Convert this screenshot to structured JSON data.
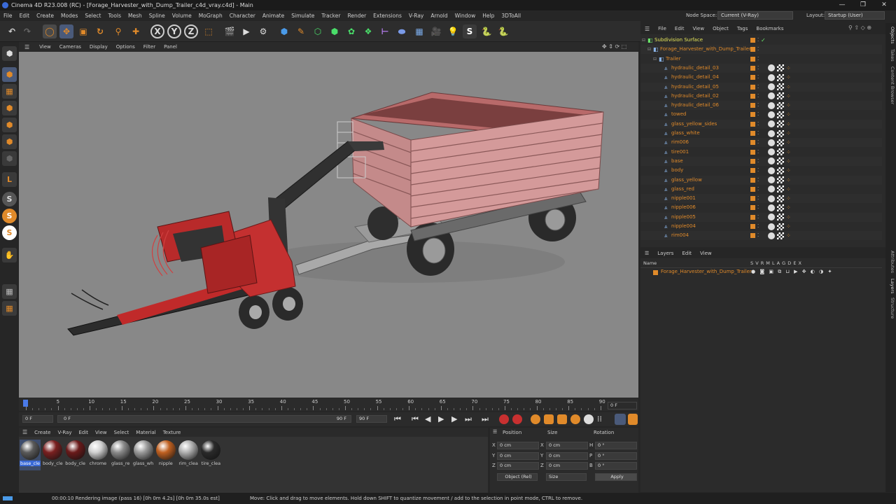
{
  "title_bar": {
    "text": "Cinema 4D R23.008 (RC) - [Forage_Harvester_with_Dump_Trailer_c4d_vray.c4d] - Main",
    "minimize": "—",
    "maximize": "❐",
    "close": "✕"
  },
  "menu": [
    "File",
    "Edit",
    "Create",
    "Modes",
    "Select",
    "Tools",
    "Mesh",
    "Spline",
    "Volume",
    "MoGraph",
    "Character",
    "Animate",
    "Simulate",
    "Tracker",
    "Render",
    "Extensions",
    "V-Ray",
    "Arnold",
    "Window",
    "Help",
    "3DToAll"
  ],
  "node_space": {
    "label": "Node Space:",
    "value": "Current (V-Ray)"
  },
  "layout": {
    "label": "Layout:",
    "value": "Startup (User)"
  },
  "viewport_menu": [
    "View",
    "Cameras",
    "Display",
    "Options",
    "Filter",
    "Panel"
  ],
  "object_menu": [
    "File",
    "Edit",
    "View",
    "Object",
    "Tags",
    "Bookmarks"
  ],
  "objects": [
    {
      "name": "Subdivision Surface",
      "level": 0,
      "color": "#e6e65a"
    },
    {
      "name": "Forage_Harvester_with_Dump_Trailer",
      "level": 1,
      "color": "#e08a2a"
    },
    {
      "name": "Trailer",
      "level": 2,
      "color": "#e08a2a"
    },
    {
      "name": "hydraulic_detail_03",
      "level": 3,
      "color": "#e08a2a"
    },
    {
      "name": "hydraulic_detail_04",
      "level": 3,
      "color": "#e08a2a"
    },
    {
      "name": "hydraulic_detail_05",
      "level": 3,
      "color": "#e08a2a"
    },
    {
      "name": "hydraulic_detail_02",
      "level": 3,
      "color": "#e08a2a"
    },
    {
      "name": "hydraulic_detail_06",
      "level": 3,
      "color": "#e08a2a"
    },
    {
      "name": "towed",
      "level": 3,
      "color": "#e08a2a"
    },
    {
      "name": "glass_yellow_sides",
      "level": 3,
      "color": "#e08a2a"
    },
    {
      "name": "glass_white",
      "level": 3,
      "color": "#e08a2a"
    },
    {
      "name": "rim006",
      "level": 3,
      "color": "#e08a2a"
    },
    {
      "name": "tire001",
      "level": 3,
      "color": "#e08a2a"
    },
    {
      "name": "base",
      "level": 3,
      "color": "#e08a2a"
    },
    {
      "name": "body",
      "level": 3,
      "color": "#e08a2a"
    },
    {
      "name": "glass_yellow",
      "level": 3,
      "color": "#e08a2a"
    },
    {
      "name": "glass_red",
      "level": 3,
      "color": "#e08a2a"
    },
    {
      "name": "nipple001",
      "level": 3,
      "color": "#e08a2a"
    },
    {
      "name": "nipple006",
      "level": 3,
      "color": "#e08a2a"
    },
    {
      "name": "nipple005",
      "level": 3,
      "color": "#e08a2a"
    },
    {
      "name": "nipple004",
      "level": 3,
      "color": "#e08a2a"
    },
    {
      "name": "rim004",
      "level": 3,
      "color": "#e08a2a"
    }
  ],
  "layers_menu": [
    "Layers",
    "Edit",
    "View"
  ],
  "layers_header": {
    "name": "Name",
    "cols": "S V R M L A G D E X"
  },
  "layers": [
    {
      "name": "Forage_Harvester_with_Dump_Trailer"
    }
  ],
  "timeline": {
    "ticks": [
      "0",
      "5",
      "10",
      "15",
      "20",
      "25",
      "30",
      "35",
      "40",
      "45",
      "50",
      "55",
      "60",
      "65",
      "70",
      "75",
      "80",
      "85",
      "90"
    ],
    "current": "0 F",
    "start": "0 F",
    "range_start": "0 F",
    "range_end": "90 F",
    "end": "90 F"
  },
  "material_menu": [
    "Create",
    "V-Ray",
    "Edit",
    "View",
    "Select",
    "Material",
    "Texture"
  ],
  "materials": [
    {
      "name": "base_cle",
      "color": "#5a5a5a"
    },
    {
      "name": "body_cle",
      "color": "#7a2020"
    },
    {
      "name": "body_cle",
      "color": "#6a1a1a"
    },
    {
      "name": "chrome",
      "color": "#d0d0d0"
    },
    {
      "name": "glass_re",
      "color": "#8a8a8a"
    },
    {
      "name": "glass_wh",
      "color": "#9a9a9a"
    },
    {
      "name": "nipple",
      "color": "#c06020"
    },
    {
      "name": "rim_clea",
      "color": "#b0b0b0"
    },
    {
      "name": "tire_clea",
      "color": "#2a2a2a"
    }
  ],
  "coords": {
    "headers": [
      "Position",
      "Size",
      "Rotation"
    ],
    "rows": [
      {
        "axis": "X",
        "pos": "0 cm",
        "saxis": "X",
        "size": "0 cm",
        "raxis": "H",
        "rot": "0 °"
      },
      {
        "axis": "Y",
        "pos": "0 cm",
        "saxis": "Y",
        "size": "0 cm",
        "raxis": "P",
        "rot": "0 °"
      },
      {
        "axis": "Z",
        "pos": "0 cm",
        "saxis": "Z",
        "size": "0 cm",
        "raxis": "B",
        "rot": "0 °"
      }
    ],
    "mode": "Object (Rel)",
    "size_mode": "Size",
    "apply": "Apply"
  },
  "right_tabs": [
    "Objects",
    "Takes",
    "Content Browser",
    "Attributes",
    "Layers",
    "Structure"
  ],
  "status": {
    "render": "00:00:10 Rendering image (pass 16) [0h  0m  4.2s] [0h  0m 35.0s est]",
    "hint": "Move: Click and drag to move elements. Hold down SHIFT to quantize movement / add to the selection in point mode, CTRL to remove."
  },
  "accent": "#e08a2a"
}
